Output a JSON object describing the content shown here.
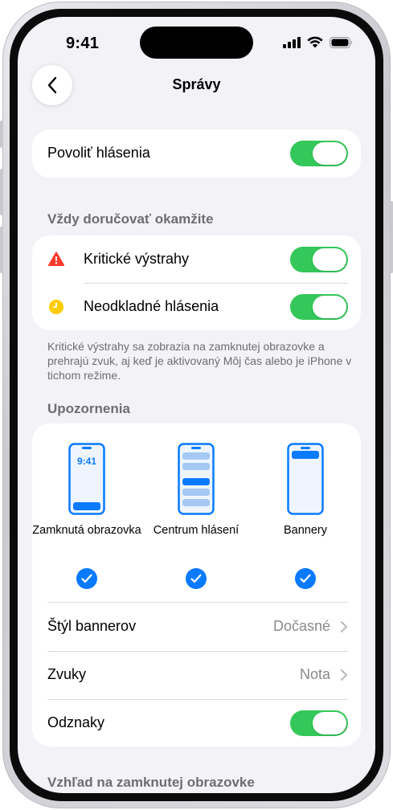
{
  "status_bar": {
    "time": "9:41"
  },
  "nav": {
    "title": "Správy"
  },
  "allow_notifications": {
    "label": "Povoliť hlásenia",
    "on": true
  },
  "deliver_immediately": {
    "header": "Vždy doručovať okamžite",
    "critical": {
      "label": "Kritické výstrahy",
      "on": true
    },
    "urgent": {
      "label": "Neodkladné hlásenia",
      "on": true
    },
    "footnote": "Kritické výstrahy sa zobrazia na zamknutej obrazovke a prehrajú zvuk, aj keď je aktivovaný Môj čas alebo je iPhone v tichom režime."
  },
  "alerts": {
    "header": "Upozornenia",
    "styles": [
      {
        "label": "Zamknutá obrazovka",
        "preview_time": "9:41",
        "checked": true
      },
      {
        "label": "Centrum hlásení",
        "checked": true
      },
      {
        "label": "Bannery",
        "checked": true
      }
    ],
    "banner_style": {
      "label": "Štýl bannerov",
      "value": "Dočasné"
    },
    "sounds": {
      "label": "Zvuky",
      "value": "Nota"
    },
    "badges": {
      "label": "Odznaky",
      "on": true
    }
  },
  "lock_screen_section": {
    "header": "Vzhľad na zamknutej obrazovke"
  },
  "colors": {
    "toggle_on": "#34c759",
    "accent": "#0a7aff",
    "critical": "#ff3b30",
    "urgent": "#ffcc00"
  }
}
